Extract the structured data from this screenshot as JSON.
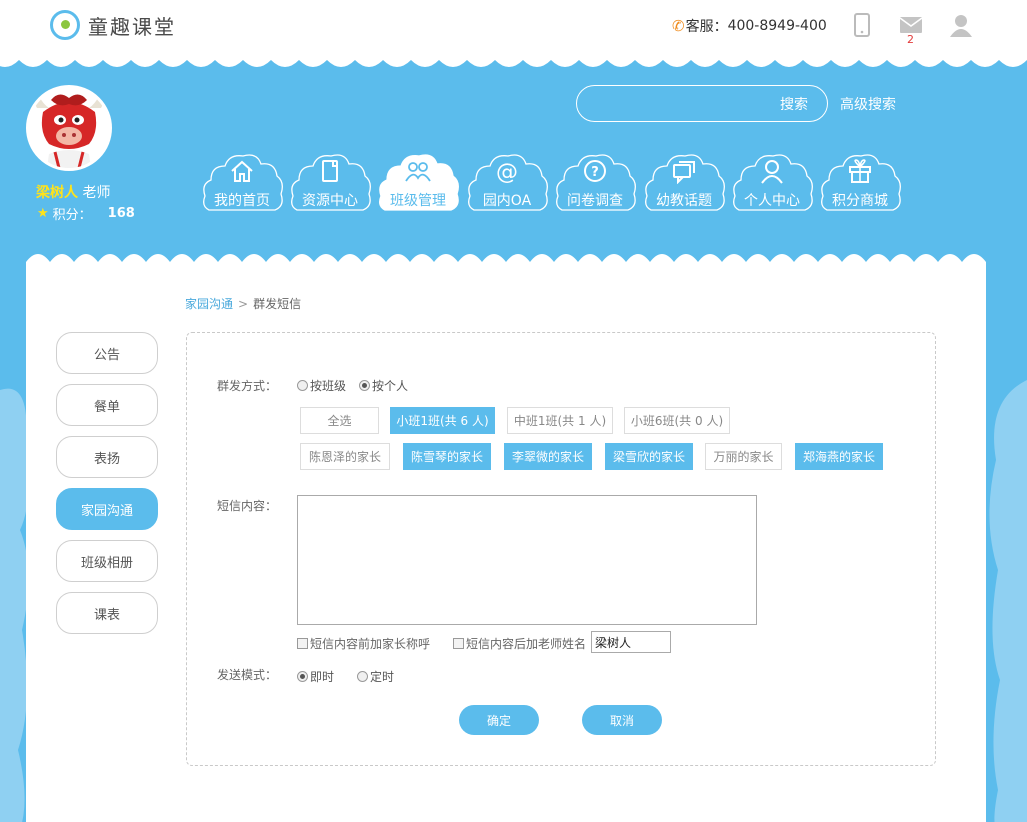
{
  "brand": {
    "name": "童趣课堂"
  },
  "topbar": {
    "hotline_label": "客服：",
    "hotline_number": "400-8949-400",
    "mail_count": "2"
  },
  "profile": {
    "name": "梁树人",
    "role": "老师",
    "points_label": "积分：",
    "points_value": "168"
  },
  "search": {
    "button": "搜索",
    "advanced": "高级搜索"
  },
  "nav": [
    {
      "label": "我的首页",
      "icon": "home-icon"
    },
    {
      "label": "资源中心",
      "icon": "document-icon"
    },
    {
      "label": "班级管理",
      "icon": "group-icon",
      "active": true
    },
    {
      "label": "园内OA",
      "icon": "at-icon"
    },
    {
      "label": "问卷调查",
      "icon": "question-icon"
    },
    {
      "label": "幼教话题",
      "icon": "chat-icon"
    },
    {
      "label": "个人中心",
      "icon": "person-icon"
    },
    {
      "label": "积分商城",
      "icon": "gift-icon"
    }
  ],
  "breadcrumb": {
    "parent": "家园沟通",
    "current": "群发短信"
  },
  "sidebar": [
    {
      "label": "公告"
    },
    {
      "label": "餐单"
    },
    {
      "label": "表扬"
    },
    {
      "label": "家园沟通",
      "active": true
    },
    {
      "label": "班级相册"
    },
    {
      "label": "课表"
    }
  ],
  "form": {
    "send_method_label": "群发方式：",
    "method_class": "按班级",
    "method_person": "按个人",
    "class_chips": [
      {
        "label": "全选",
        "selected": false
      },
      {
        "label": "小班1班(共 6 人)",
        "selected": true
      },
      {
        "label": "中班1班(共 1 人)",
        "selected": false
      },
      {
        "label": "小班6班(共 0 人)",
        "selected": false
      }
    ],
    "parent_chips": [
      {
        "label": "陈恩泽的家长",
        "selected": false
      },
      {
        "label": "陈雪琴的家长",
        "selected": true
      },
      {
        "label": "李翠微的家长",
        "selected": true
      },
      {
        "label": "梁雪欣的家长",
        "selected": true
      },
      {
        "label": "万丽的家长",
        "selected": false
      },
      {
        "label": "郑海燕的家长",
        "selected": true
      }
    ],
    "sms_content_label": "短信内容：",
    "sms_content_value": "",
    "prefix_checkbox": "短信内容前加家长称呼",
    "suffix_checkbox": "短信内容后加老师姓名",
    "teacher_name_value": "梁树人",
    "send_mode_label": "发送模式：",
    "mode_now": "即时",
    "mode_timed": "定时",
    "confirm": "确定",
    "cancel": "取消"
  },
  "colors": {
    "sky": "#5bbcec",
    "name_yellow": "#ffe31a",
    "phone_orange": "#f08c1e",
    "badge_red": "#e23b3b"
  }
}
